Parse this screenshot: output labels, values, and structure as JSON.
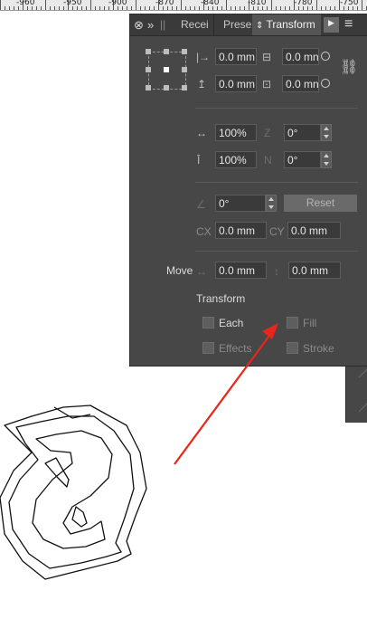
{
  "ruler": {
    "labels": [
      "-960",
      "-950",
      "-900",
      "-870",
      "-840",
      "-810",
      "-780",
      "-750"
    ]
  },
  "panel": {
    "tabs": [
      {
        "label": "Recei",
        "active": false
      },
      {
        "label": "Prese",
        "active": false
      },
      {
        "label": "Transform",
        "active": true
      }
    ],
    "icons": {
      "close": "⊗",
      "collapse": "»",
      "menu": "≡",
      "play": "▶"
    },
    "position": {
      "x_value": "0.0 mm",
      "y_value": "0.0 mm",
      "w_value": "0.0 mn",
      "h_value": "0.0 mn"
    },
    "scale": {
      "h_value": "100%",
      "v_value": "100%"
    },
    "skew": {
      "h_value": "0°",
      "v_value": "0°"
    },
    "rotate": {
      "value": "0°",
      "reset_label": "Reset"
    },
    "origin": {
      "cx_label": "CX",
      "cx_value": "0.0 mm",
      "cy_label": "CY",
      "cy_value": "0.0 mm"
    },
    "move": {
      "label": "Move",
      "h_value": "0.0 mm",
      "v_value": "0.0 mm"
    },
    "transform_section": {
      "title": "Transform",
      "options": [
        {
          "label": "Each",
          "enabled": true
        },
        {
          "label": "Fill",
          "enabled": false
        },
        {
          "label": "Effects",
          "enabled": false
        },
        {
          "label": "Stroke",
          "enabled": false
        }
      ]
    }
  },
  "annotation": {
    "arrow_color": "#e8261c"
  }
}
